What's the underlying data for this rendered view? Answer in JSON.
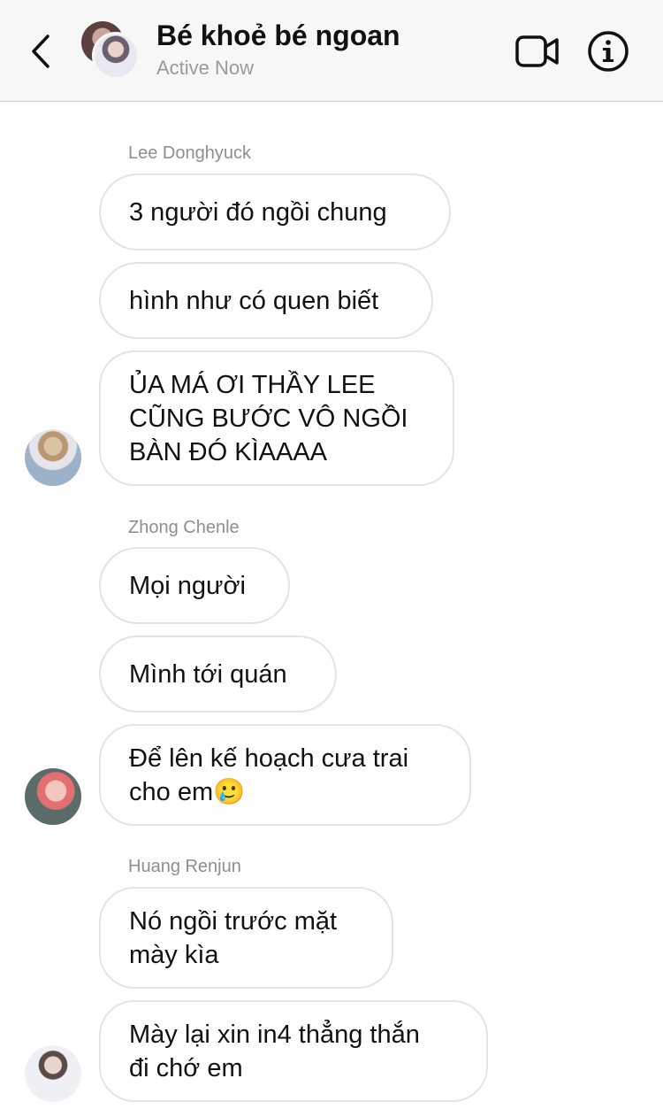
{
  "header": {
    "title": "Bé khoẻ bé ngoan",
    "status": "Active Now",
    "icons": {
      "back": "chevron-left-icon",
      "video": "video-camera-icon",
      "info": "info-icon"
    }
  },
  "messages": [
    {
      "sender": "Lee Donghyuck",
      "bubbles": [
        "3 người đó ngồi chung",
        "hình như có quen biết",
        "ỦA MÁ ƠI THẦY LEE\nCŨNG BƯỚC VÔ NGỒI\nBÀN ĐÓ KÌAAAA"
      ]
    },
    {
      "sender": "Zhong Chenle",
      "bubbles": [
        "Mọi người",
        "Mình tới quán",
        "Để lên kế hoạch cưa trai\ncho em🥲"
      ]
    },
    {
      "sender": "Huang Renjun",
      "bubbles": [
        "Nó ngồi trước mặt\nmày kìa",
        "Mày lại xin in4 thẳng thắn\nđi chớ em"
      ]
    }
  ],
  "colors": {
    "header_bg": "#f7f7f7",
    "bubble_border": "#e3e3e3",
    "sender_text": "#8e8e8e",
    "status_text": "#9a9a9a"
  }
}
